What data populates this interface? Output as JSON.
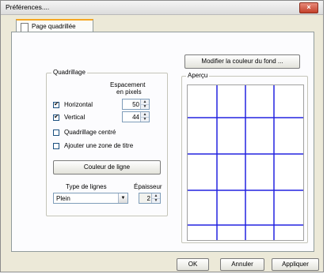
{
  "window": {
    "title": "Préférences....",
    "close_label": "×"
  },
  "tab": {
    "label": "Page quadrillée"
  },
  "change_color_button": "Modifier la couleur du fond ...",
  "grid_group": {
    "legend": "Quadrillage",
    "spacing_header_line1": "Espacement",
    "spacing_header_line2": "en pixels",
    "horizontal": {
      "label": "Horizontal",
      "checked": true,
      "value": "50"
    },
    "vertical": {
      "label": "Vertical",
      "checked": true,
      "value": "44"
    },
    "centered": {
      "label": "Quadrillage centré",
      "checked": false
    },
    "title_zone": {
      "label": "Ajouter une zone de titre",
      "checked": false
    },
    "line_color_button": "Couleur de ligne",
    "line_type_label": "Type de lignes",
    "thickness_label": "Épaisseur",
    "line_type_value": "Plein",
    "thickness_value": "2"
  },
  "preview": {
    "legend": "Aperçu",
    "line_color": "#2323e0"
  },
  "footer": {
    "ok": "OK",
    "cancel": "Annuler",
    "apply": "Appliquer"
  },
  "checkmark": "✔",
  "spin_up": "▲",
  "spin_down": "▼",
  "combo_arrow": "▼"
}
